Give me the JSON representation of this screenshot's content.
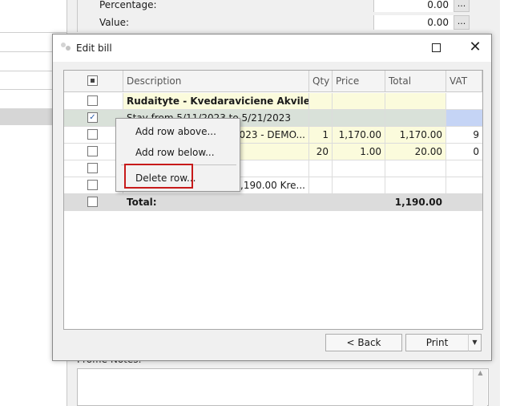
{
  "background": {
    "fields": [
      {
        "label": "Percentage:",
        "value": "0.00",
        "button": "..."
      },
      {
        "label": "Value:",
        "value": "0.00",
        "button": "..."
      }
    ],
    "notes_label": "Proffie Notes:"
  },
  "dialog": {
    "title": "Edit bill",
    "columns": {
      "description": "Description",
      "qty": "Qty",
      "price": "Price",
      "total": "Total",
      "vat": "VAT"
    },
    "rows": [
      {
        "desc": "Rudaityte - Kvedaraviciene Akvile",
        "qty": "",
        "price": "",
        "total": "",
        "vat": "",
        "checked": false
      },
      {
        "desc": "Stay from 5/11/2023 to 5/21/2023",
        "qty": "",
        "price": "",
        "total": "",
        "vat": "",
        "checked": true
      },
      {
        "desc": "2023 - DEMO...",
        "qty": "1",
        "price": "1,170.00",
        "total": "1,170.00",
        "vat": "9",
        "checked": false
      },
      {
        "desc": "",
        "qty": "20",
        "price": "1.00",
        "total": "20.00",
        "vat": "0",
        "checked": false
      },
      {
        "desc": "",
        "qty": "",
        "price": "",
        "total": "",
        "vat": "",
        "checked": false
      },
      {
        "desc": "1,190.00 Kre...",
        "qty": "",
        "price": "",
        "total": "",
        "vat": "",
        "checked": false
      }
    ],
    "total_row": {
      "label": "Total:",
      "total": "1,190.00"
    },
    "context_menu": {
      "add_above": "Add row above...",
      "add_below": "Add row below...",
      "delete": "Delete row..."
    },
    "buttons": {
      "back": "< Back",
      "print": "Print"
    },
    "colors": {
      "highlight": "#c71a1a",
      "yellow_row": "#fbfbdc",
      "selected_row": "#d9e1d9",
      "vat_selected": "#c5d4f5"
    }
  }
}
